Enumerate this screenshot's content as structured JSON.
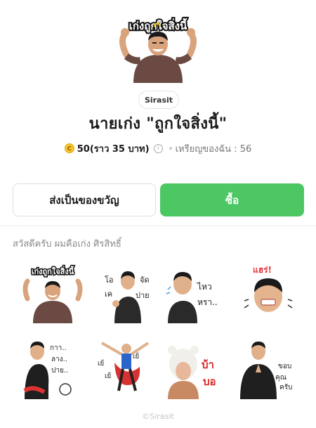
{
  "product": {
    "hero_caption": "เก่งถูกใจสิ่งนี้",
    "creator": "Sirasit",
    "title": "นายเก่ง \"ถูกใจสิ่งนี้\"",
    "price": "50(ราว 35 บาท)",
    "coin_symbol": "C",
    "info_symbol": "i",
    "balance": "เหรียญของฉัน : 56"
  },
  "actions": {
    "gift_label": "ส่งเป็นของขวัญ",
    "buy_label": "ซื้อ"
  },
  "description": "สวัสดีครับ ผมคือเก่ง ศิรสิทธิ์",
  "stickers": {
    "s1": "เก่งถูกใจสิ่งนี้",
    "s2a": "โอ",
    "s2b": "เค",
    "s2c": "จัด",
    "s2d": "ปาย",
    "s3a": "ไหว",
    "s3b": "หรา..",
    "s4": "แฮร่!",
    "s5a": "กาา..",
    "s5b": "ลาง..",
    "s5c": "ปาย..",
    "s6a": "เย้",
    "s6b": "เย้",
    "s6c": "เย้",
    "s7a": "บ้า",
    "s7b": "บอ",
    "s8a": "ขอบ",
    "s8b": "คุณ",
    "s8c": "ครับ"
  },
  "footer": "©Sirasit",
  "colors": {
    "buy_green": "#4cc764",
    "text_dark": "#1a1a1a",
    "muted": "#8a8a8a"
  }
}
